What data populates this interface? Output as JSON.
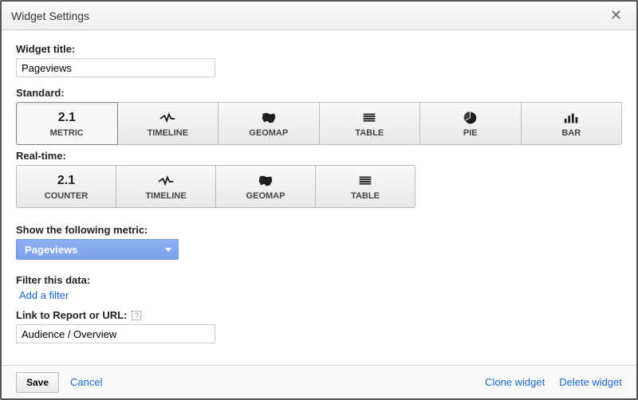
{
  "dialog": {
    "title": "Widget Settings"
  },
  "fields": {
    "widget_title_label": "Widget title:",
    "widget_title_value": "Pageviews",
    "standard_label": "Standard:",
    "realtime_label": "Real-time:",
    "show_metric_label": "Show the following metric:",
    "metric_selected": "Pageviews",
    "filter_label": "Filter this data:",
    "add_filter_link": "Add a filter",
    "link_report_label": "Link to Report or URL:",
    "link_report_value": "Audience / Overview"
  },
  "types": {
    "standard": [
      {
        "id": "metric",
        "label": "METRIC",
        "icon": "num21",
        "selected": true
      },
      {
        "id": "timeline",
        "label": "TIMELINE",
        "icon": "spark",
        "selected": false
      },
      {
        "id": "geomap",
        "label": "GEOMAP",
        "icon": "geo",
        "selected": false
      },
      {
        "id": "table",
        "label": "TABLE",
        "icon": "table",
        "selected": false
      },
      {
        "id": "pie",
        "label": "PIE",
        "icon": "pie",
        "selected": false
      },
      {
        "id": "bar",
        "label": "BAR",
        "icon": "bar",
        "selected": false
      }
    ],
    "realtime": [
      {
        "id": "counter",
        "label": "COUNTER",
        "icon": "num21",
        "selected": false
      },
      {
        "id": "timeline",
        "label": "TIMELINE",
        "icon": "spark",
        "selected": false
      },
      {
        "id": "geomap",
        "label": "GEOMAP",
        "icon": "geo",
        "selected": false
      },
      {
        "id": "table",
        "label": "TABLE",
        "icon": "table",
        "selected": false
      }
    ]
  },
  "footer": {
    "save": "Save",
    "cancel": "Cancel",
    "clone": "Clone widget",
    "delete": "Delete widget"
  }
}
